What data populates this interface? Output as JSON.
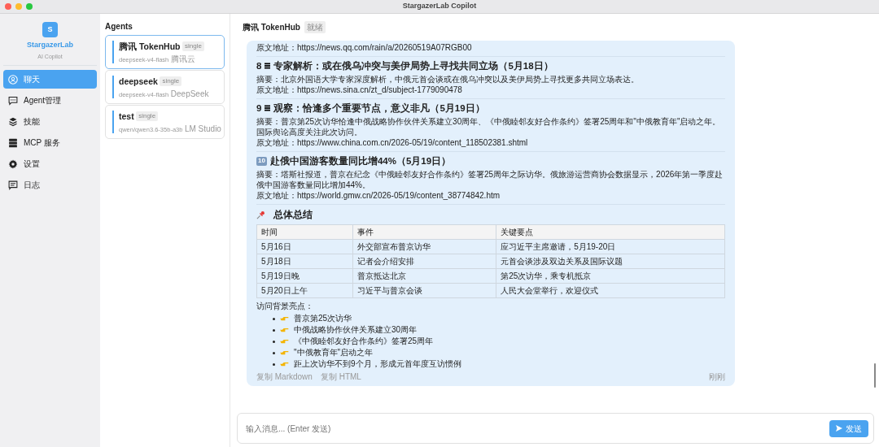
{
  "window": {
    "title": "StargazerLab Copilot"
  },
  "brand": {
    "logo_letter": "S",
    "name": "StargazerLab",
    "subtitle": "AI Copilot"
  },
  "nav": [
    {
      "label": "聊天",
      "kind": "person",
      "selected": true
    },
    {
      "label": "Agent管理",
      "kind": "chat",
      "selected": false
    },
    {
      "label": "技能",
      "kind": "layers",
      "selected": false
    },
    {
      "label": "MCP 服务",
      "kind": "server",
      "selected": false
    },
    {
      "label": "设置",
      "kind": "gear",
      "selected": false
    },
    {
      "label": "日志",
      "kind": "log",
      "selected": false
    }
  ],
  "agents": {
    "title": "Agents",
    "items": [
      {
        "name": "腾讯 TokenHub",
        "tag": "single",
        "model": "deepseek-v4-flash",
        "provider": "腾讯云",
        "selected": true
      },
      {
        "name": "deepseek",
        "tag": "single",
        "model": "deepseek-v4-flash",
        "provider": "DeepSeek",
        "selected": false
      },
      {
        "name": "test",
        "tag": "single",
        "model": "qwen/qwen3.6-35b-a3b",
        "provider": "LM Studio",
        "selected": false
      }
    ]
  },
  "chat": {
    "title": "腾讯 TokenHub",
    "status": "就绪",
    "message": {
      "lead_url": "原文地址：https://news.qq.com/rain/a/20260519A07RGB00",
      "news": [
        {
          "num": "8",
          "kind": "keycap",
          "title": "专家解析：或在俄乌冲突与美伊局势上寻找共同立场（5月18日）",
          "summary": "摘要：北京外国语大学专家深度解析，中俄元首会谈或在俄乌冲突以及美伊局势上寻找更多共同立场表达。",
          "url": "原文地址：https://news.sina.cn/zt_d/subject-1779090478"
        },
        {
          "num": "9",
          "kind": "keycap",
          "title": "观察：恰逢多个重要节点，意义非凡（5月19日）",
          "summary": "摘要：普京第25次访华恰逢中俄战略协作伙伴关系建立30周年、《中俄睦邻友好合作条约》签署25周年和\"中俄教育年\"启动之年。国际舆论高度关注此次访问。",
          "url": "原文地址：https://www.china.com.cn/2026-05/19/content_118502381.shtml"
        },
        {
          "num": "10",
          "kind": "tile",
          "title": "赴俄中国游客数量同比增44%（5月19日）",
          "summary": "摘要：塔斯社报道，普京在纪念《中俄睦邻友好合作条约》签署25周年之际访华。俄旅游运营商协会数据显示，2026年第一季度赴俄中国游客数量同比增加44%。",
          "url": "原文地址：https://world.gmw.cn/2026-05/19/content_38774842.htm"
        }
      ],
      "summary_title": "总体总结",
      "table": {
        "columns": [
          "时间",
          "事件",
          "关键要点"
        ],
        "rows": [
          [
            "5月16日",
            "外交部宣布普京访华",
            "应习近平主席邀请，5月19-20日"
          ],
          [
            "5月18日",
            "记者会介绍安排",
            "元首会谈涉及双边关系及国际议题"
          ],
          [
            "5月19日晚",
            "普京抵达北京",
            "第25次访华，乘专机抵京"
          ],
          [
            "5月20日上午",
            "习近平与普京会谈",
            "人民大会堂举行，欢迎仪式"
          ]
        ]
      },
      "highlights_label": "访问背景亮点：",
      "highlights": [
        "普京第25次访华",
        "中俄战略协作伙伴关系建立30周年",
        "《中俄睦邻友好合作条约》签署25周年",
        "\"中俄教育年\"启动之年",
        "距上次访华不到9个月，形成元首年度互访惯例"
      ],
      "actions": [
        "复制 Markdown",
        "复制 HTML"
      ],
      "time": "刚刚"
    }
  },
  "composer": {
    "placeholder": "输入消息... (Enter 发送)",
    "send": "发送"
  }
}
